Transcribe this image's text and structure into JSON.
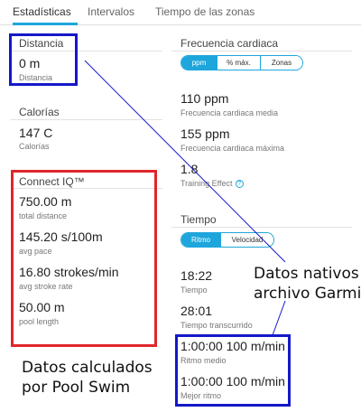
{
  "tabs": [
    {
      "label": "Estadísticas",
      "active": true
    },
    {
      "label": "Intervalos",
      "active": false
    },
    {
      "label": "Tiempo de las zonas",
      "active": false
    }
  ],
  "left": {
    "distancia": {
      "title": "Distancia",
      "value": "0 m",
      "label": "Distancia"
    },
    "calorias": {
      "title": "Calorías",
      "value": "147 C",
      "label": "Calorías"
    },
    "connect_iq": {
      "title": "Connect IQ™",
      "rows": [
        {
          "value": "750.00 m",
          "label": "total distance"
        },
        {
          "value": "145.20 s/100m",
          "label": "avg pace"
        },
        {
          "value": "16.80 strokes/min",
          "label": "avg stroke rate"
        },
        {
          "value": "50.00 m",
          "label": "pool length"
        }
      ]
    }
  },
  "right": {
    "frecuencia": {
      "title": "Frecuencia cardiaca",
      "toggle": [
        "ppm",
        "% máx.",
        "Zonas"
      ],
      "rows": [
        {
          "value": "110 ppm",
          "label": "Frecuencia cardiaca media"
        },
        {
          "value": "155 ppm",
          "label": "Frecuencia cardiaca máxima"
        },
        {
          "value": "1.8",
          "label": "Training Effect"
        }
      ],
      "info_icon": "?"
    },
    "tiempo": {
      "title": "Tiempo",
      "toggle": [
        "Ritmo",
        "Velocidad"
      ],
      "rows": [
        {
          "value": "18:22",
          "label": "Tiempo"
        },
        {
          "value": "28:01",
          "label": "Tiempo transcurrido"
        },
        {
          "value": "1:00:00 100 m/min",
          "label": "Ritmo medio"
        },
        {
          "value": "1:00:00 100 m/min",
          "label": "Mejor ritmo"
        }
      ]
    }
  },
  "annotations": {
    "nativos": [
      "Datos nativos",
      "archivo Garmin"
    ],
    "calculados": [
      "Datos calculados",
      "por Pool Swim"
    ]
  },
  "colors": {
    "accent": "#1ea6dc",
    "annotation_blue": "#1418c8",
    "annotation_red": "#e0262a"
  }
}
